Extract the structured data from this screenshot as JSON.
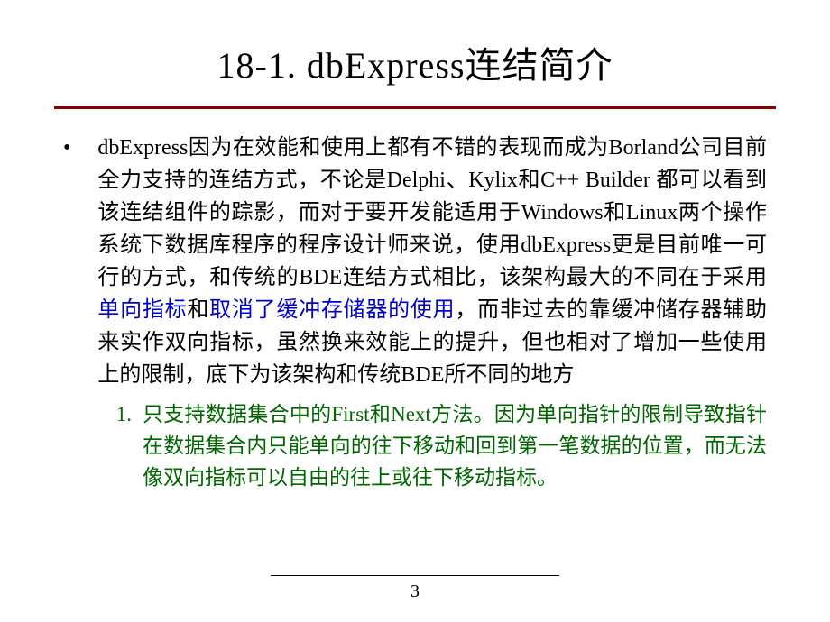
{
  "title": "18-1. dbExpress连结简介",
  "main_bullet": {
    "marker": "•",
    "text_before_link1": "dbExpress因为在效能和使用上都有不错的表现而成为Borland公司目前全力支持的连结方式，不论是Delphi、Kylix和C++ Builder 都可以看到该连结组件的踪影，而对于要开发能适用于Windows和Linux两个操作系统下数据库程序的程序设计师来说，使用dbExpress更是目前唯一可行的方式，和传统的BDE连结方式相比，该架构最大的不同在于采用",
    "link1": "单向指标",
    "mid_text": "和",
    "link2": "取消了缓冲存储器的使用",
    "text_after_link2": "，而非过去的靠缓冲储存器辅助来实作双向指标，虽然换来效能上的提升，但也相对了增加一些使用上的限制，底下为该架构和传统BDE所不同的地方"
  },
  "sub_item": {
    "number": "1.",
    "text": "只支持数据集合中的First和Next方法。因为单向指针的限制导致指针在数据集合内只能单向的往下移动和回到第一笔数据的位置，而无法像双向指标可以自由的往上或往下移动指标。"
  },
  "page_number": "3"
}
